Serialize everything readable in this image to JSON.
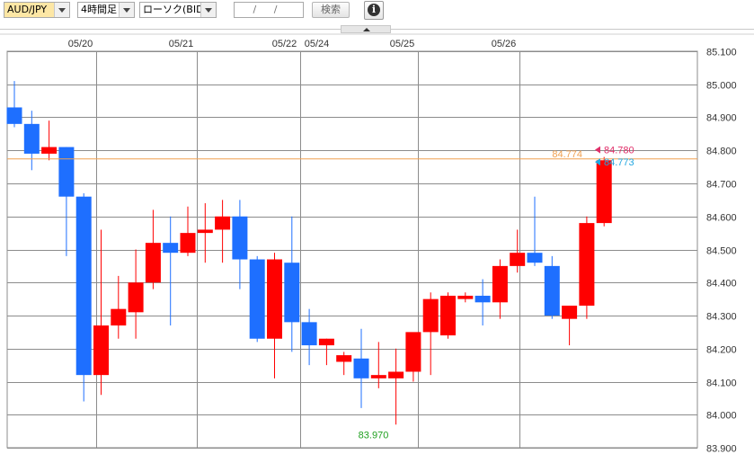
{
  "toolbar": {
    "pair": "AUD/JPY",
    "timeframe": "4時間足",
    "chart_type": "ローソク(BID)",
    "date_value": "/ /",
    "search_label": "検索",
    "info_glyph": "i"
  },
  "colors": {
    "up": "#ff0000",
    "down": "#1e6fff",
    "grid": "#8c8c8c",
    "current_line": "#f0a050",
    "ask_label": "#e0306a",
    "bid_label": "#21a6e0",
    "low_label": "#20a020",
    "axis_text": "#333333"
  },
  "chart_data": {
    "type": "candlestick",
    "ylim": [
      83.9,
      85.1
    ],
    "yticks": [
      "85.100",
      "85.000",
      "84.900",
      "84.800",
      "84.700",
      "84.600",
      "84.500",
      "84.400",
      "84.300",
      "84.200",
      "84.100",
      "84.000",
      "83.900"
    ],
    "yvalues": [
      85.1,
      85.0,
      84.9,
      84.8,
      84.7,
      84.6,
      84.5,
      84.4,
      84.3,
      84.2,
      84.1,
      84.0,
      83.9
    ],
    "date_labels": [
      {
        "label": "05/20",
        "index": 4.72
      },
      {
        "label": "05/21",
        "index": 10.5
      },
      {
        "label": "05/22",
        "index": 16.47
      },
      {
        "label": "05/24",
        "index": 16.47
      },
      {
        "label": "05/25",
        "index": 23.28
      },
      {
        "label": "05/26",
        "index": 29.1
      }
    ],
    "candles": [
      {
        "o": 84.93,
        "h": 85.01,
        "l": 84.87,
        "c": 84.88
      },
      {
        "o": 84.88,
        "h": 84.92,
        "l": 84.74,
        "c": 84.79
      },
      {
        "o": 84.79,
        "h": 84.89,
        "l": 84.77,
        "c": 84.81
      },
      {
        "o": 84.81,
        "h": 84.81,
        "l": 84.48,
        "c": 84.66
      },
      {
        "o": 84.66,
        "h": 84.67,
        "l": 84.04,
        "c": 84.12
      },
      {
        "o": 84.12,
        "h": 84.56,
        "l": 84.06,
        "c": 84.27
      },
      {
        "o": 84.27,
        "h": 84.42,
        "l": 84.23,
        "c": 84.32
      },
      {
        "o": 84.31,
        "h": 84.5,
        "l": 84.23,
        "c": 84.4
      },
      {
        "o": 84.4,
        "h": 84.62,
        "l": 84.38,
        "c": 84.52
      },
      {
        "o": 84.52,
        "h": 84.6,
        "l": 84.27,
        "c": 84.49
      },
      {
        "o": 84.49,
        "h": 84.63,
        "l": 84.48,
        "c": 84.55
      },
      {
        "o": 84.55,
        "h": 84.64,
        "l": 84.46,
        "c": 84.56
      },
      {
        "o": 84.56,
        "h": 84.65,
        "l": 84.46,
        "c": 84.6
      },
      {
        "o": 84.6,
        "h": 84.65,
        "l": 84.38,
        "c": 84.47
      },
      {
        "o": 84.47,
        "h": 84.48,
        "l": 84.22,
        "c": 84.23
      },
      {
        "o": 84.23,
        "h": 84.49,
        "l": 84.11,
        "c": 84.47
      },
      {
        "o": 84.46,
        "h": 84.6,
        "l": 84.19,
        "c": 84.28
      },
      {
        "o": 84.28,
        "h": 84.32,
        "l": 84.15,
        "c": 84.21
      },
      {
        "o": 84.21,
        "h": 84.23,
        "l": 84.15,
        "c": 84.23
      },
      {
        "o": 84.16,
        "h": 84.19,
        "l": 84.12,
        "c": 84.18
      },
      {
        "o": 84.17,
        "h": 84.26,
        "l": 84.02,
        "c": 84.11
      },
      {
        "o": 84.11,
        "h": 84.22,
        "l": 84.08,
        "c": 84.12
      },
      {
        "o": 84.11,
        "h": 84.2,
        "l": 83.97,
        "c": 84.13
      },
      {
        "o": 84.13,
        "h": 84.23,
        "l": 84.1,
        "c": 84.25
      },
      {
        "o": 84.25,
        "h": 84.37,
        "l": 84.12,
        "c": 84.35
      },
      {
        "o": 84.24,
        "h": 84.37,
        "l": 84.23,
        "c": 84.36
      },
      {
        "o": 84.35,
        "h": 84.37,
        "l": 84.34,
        "c": 84.36
      },
      {
        "o": 84.36,
        "h": 84.41,
        "l": 84.27,
        "c": 84.34
      },
      {
        "o": 84.34,
        "h": 84.47,
        "l": 84.29,
        "c": 84.45
      },
      {
        "o": 84.45,
        "h": 84.56,
        "l": 84.43,
        "c": 84.49
      },
      {
        "o": 84.49,
        "h": 84.66,
        "l": 84.45,
        "c": 84.46
      },
      {
        "o": 84.45,
        "h": 84.48,
        "l": 84.29,
        "c": 84.3
      },
      {
        "o": 84.29,
        "h": 84.33,
        "l": 84.21,
        "c": 84.33
      },
      {
        "o": 84.33,
        "h": 84.6,
        "l": 84.29,
        "c": 84.58
      },
      {
        "o": 84.58,
        "h": 84.78,
        "l": 84.57,
        "c": 84.77
      }
    ],
    "current_price": 84.774,
    "current_label": "84.774",
    "ask_price": 84.78,
    "ask_label": "84.780",
    "bid_price": 84.773,
    "bid_label": "84.773",
    "low_annotation": {
      "price": 83.97,
      "label": "83.970",
      "index": 20.7
    }
  }
}
